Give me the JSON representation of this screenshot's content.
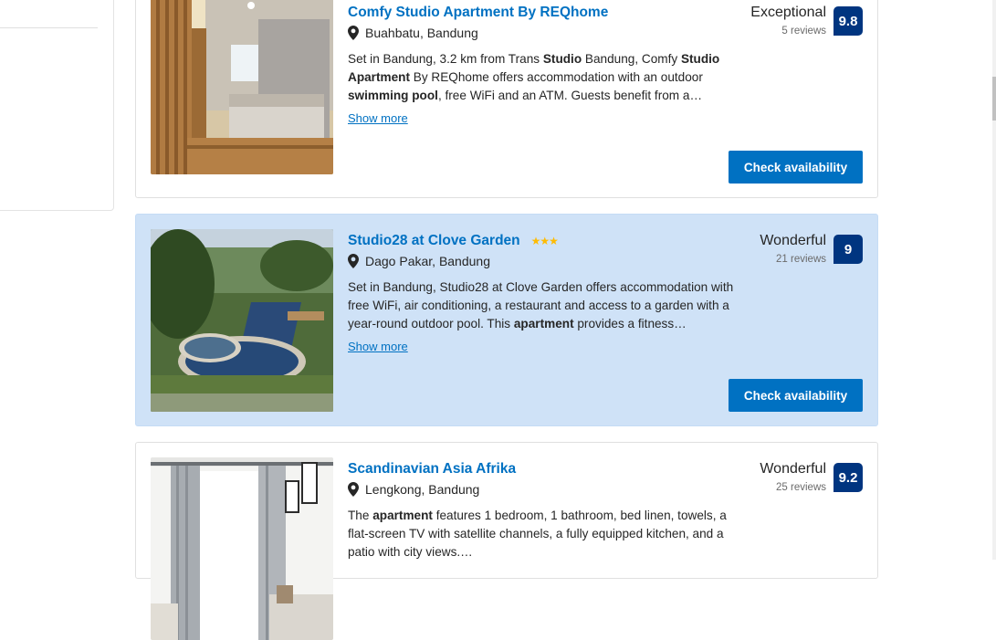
{
  "listings": [
    {
      "title": "Comfy Studio Apartment By REQhome",
      "stars": "",
      "location": "Buahbatu, Bandung",
      "description_html": "Set in Bandung, 3.2 km from Trans <b>Studio</b> Bandung, Comfy <b>Studio Apartment</b> By REQhome offers accommodation with an outdoor <b>swimming pool</b>, free WiFi and an ATM. Guests benefit from a…",
      "show_more": "Show more",
      "rating_label": "Exceptional",
      "reviews": "5 reviews",
      "score": "9.8",
      "cta": "Check availability",
      "photo": "studio-bedroom-photo"
    },
    {
      "title": "Studio28 at Clove Garden",
      "stars": "★★★",
      "location": "Dago Pakar, Bandung",
      "description_html": "Set in Bandung, Studio28 at Clove Garden offers accommodation with free WiFi, air conditioning, a restaurant and access to a garden with a year-round outdoor pool. This <b>apartment</b> provides a fitness…",
      "show_more": "Show more",
      "rating_label": "Wonderful",
      "reviews": "21 reviews",
      "score": "9",
      "cta": "Check availability",
      "photo": "pool-garden-photo"
    },
    {
      "title": "Scandinavian Asia Afrika",
      "stars": "",
      "location": "Lengkong, Bandung",
      "description_html": "The <b>apartment</b> features 1 bedroom, 1 bathroom, bed linen, towels, a flat-screen TV with satellite channels, a fully equipped kitchen, and a patio with city views.…",
      "show_more": "",
      "rating_label": "Wonderful",
      "reviews": "25 reviews",
      "score": "9.2",
      "cta": "",
      "photo": "scandinavian-room-photo"
    }
  ],
  "colors": {
    "link": "#0071c2",
    "score_badge": "#003580",
    "highlight_card": "#cfe2f7",
    "star": "#febb02"
  }
}
